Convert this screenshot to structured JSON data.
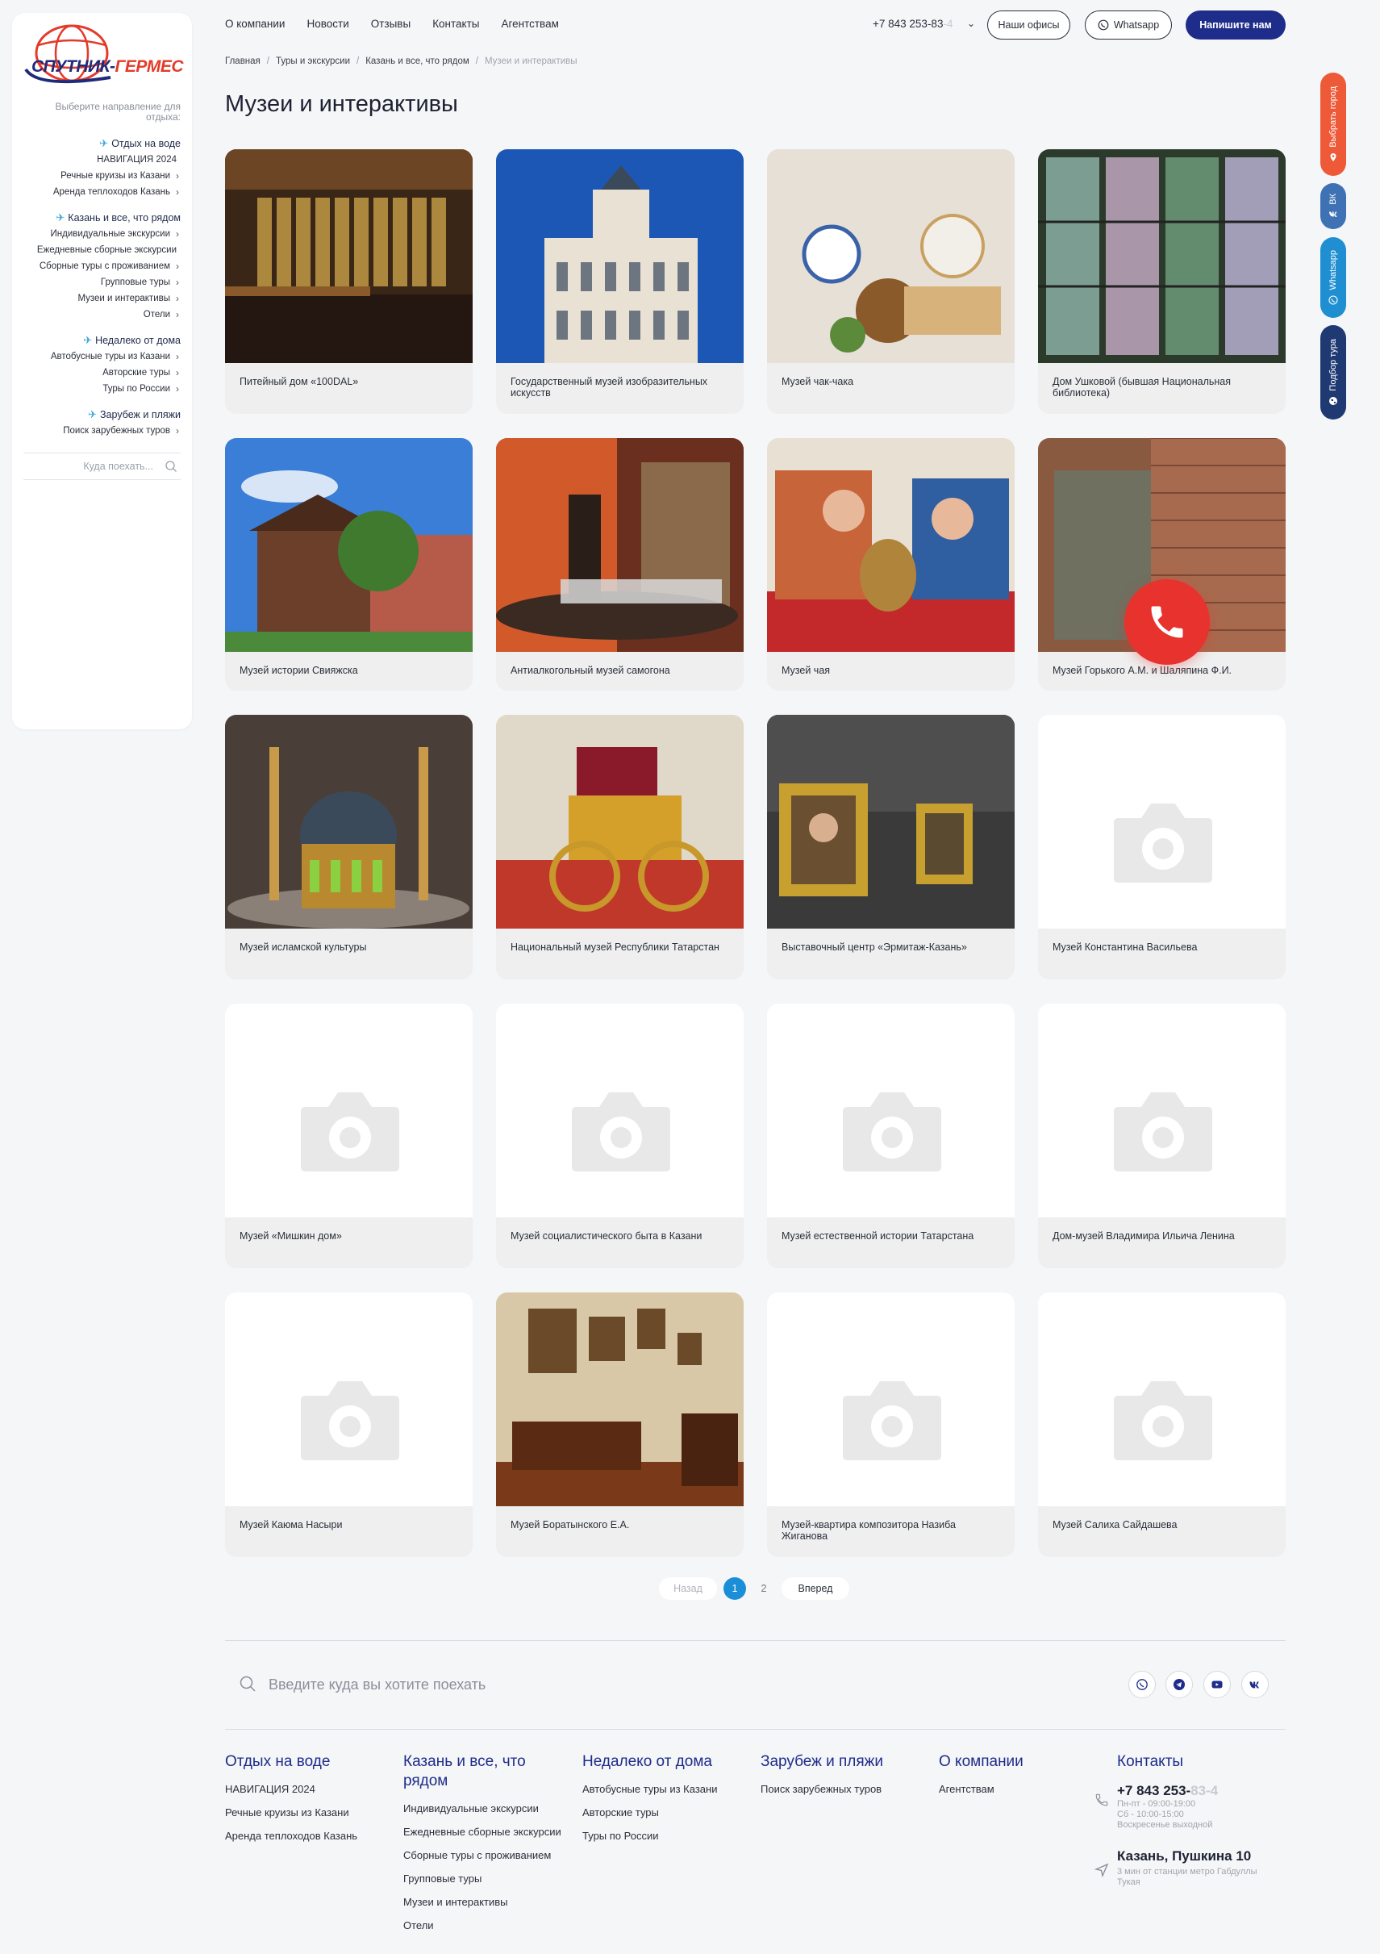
{
  "brand": {
    "name_part1": "СПУТНИК-",
    "name_part2": "ГЕРМЕС"
  },
  "sidebar": {
    "caption": "Выберите направление для отдыха:",
    "groups": [
      {
        "title": "Отдых на воде",
        "items": [
          {
            "label": "НАВИГАЦИЯ 2024",
            "chev": false
          },
          {
            "label": "Речные круизы из Казани",
            "chev": true
          },
          {
            "label": "Аренда теплоходов Казань",
            "chev": true
          }
        ]
      },
      {
        "title": "Казань и все, что рядом",
        "items": [
          {
            "label": "Индивидуальные экскурсии",
            "chev": true
          },
          {
            "label": "Ежедневные сборные экскурсии",
            "chev": false
          },
          {
            "label": "Сборные туры с проживанием",
            "chev": true
          },
          {
            "label": "Групповые туры",
            "chev": true
          },
          {
            "label": "Музеи и интерактивы",
            "chev": true
          },
          {
            "label": "Отели",
            "chev": true
          }
        ]
      },
      {
        "title": "Недалеко от дома",
        "items": [
          {
            "label": "Автобусные туры из Казани",
            "chev": true
          },
          {
            "label": "Авторские туры",
            "chev": true
          },
          {
            "label": "Туры по России",
            "chev": true
          }
        ]
      },
      {
        "title": "Зарубеж и пляжи",
        "items": [
          {
            "label": "Поиск зарубежных туров",
            "chev": true
          }
        ]
      }
    ],
    "search_placeholder": "Куда поехать..."
  },
  "topnav": {
    "links": [
      "О компании",
      "Новости",
      "Отзывы",
      "Контакты",
      "Агентствам"
    ],
    "phone_main": "+7 843 253-83",
    "phone_fade": "-4",
    "offices_label": "Наши офисы",
    "whatsapp_label": "Whatsapp",
    "write_label": "Напишите нам"
  },
  "breadcrumb": [
    "Главная",
    "Туры и экскурсии",
    "Казань и все, что рядом",
    "Музеи и интерактивы"
  ],
  "page_title": "Музеи и интерактивы",
  "cards": [
    {
      "title": "Питейный дом «100DAL»",
      "img": "bar"
    },
    {
      "title": "Государственный музей изобразительных искусств",
      "img": "building"
    },
    {
      "title": "Музей чак-чака",
      "img": "table"
    },
    {
      "title": "Дом Ушковой (бывшая Национальная библиотека)",
      "img": "glass"
    },
    {
      "title": "Музей истории Свияжска",
      "img": "house"
    },
    {
      "title": "Антиалкогольный музей самогона",
      "img": "still"
    },
    {
      "title": "Музей чая",
      "img": "tea"
    },
    {
      "title": "Музей Горького А.М. и Шаляпина Ф.И.",
      "img": "cellar"
    },
    {
      "title": "Музей исламской культуры",
      "img": "mosque"
    },
    {
      "title": "Национальный музей Республики Татарстан",
      "img": "carriage"
    },
    {
      "title": "Выставочный центр «Эрмитаж-Казань»",
      "img": "frames"
    },
    {
      "title": "Музей Константина Васильева",
      "img": "placeholder"
    },
    {
      "title": "Музей «Мишкин дом»",
      "img": "placeholder"
    },
    {
      "title": "Музей социалистического быта в Казани",
      "img": "placeholder"
    },
    {
      "title": "Музей естественной истории Татарстана",
      "img": "placeholder"
    },
    {
      "title": "Дом-музей Владимира Ильича Ленина",
      "img": "placeholder"
    },
    {
      "title": "Музей Каюма Насыри",
      "img": "placeholder"
    },
    {
      "title": "Музей Боратынского Е.А.",
      "img": "room"
    },
    {
      "title": "Музей-квартира композитора Назиба Жиганова",
      "img": "placeholder"
    },
    {
      "title": "Музей Салиха Сайдашева",
      "img": "placeholder"
    }
  ],
  "float_tabs": {
    "city": "Выбрать город",
    "vk": "ВК",
    "whatsapp": "Whatsapp",
    "tour": "Подбор тура"
  },
  "pager": {
    "prev": "Назад",
    "pages": [
      "1",
      "2"
    ],
    "next": "Вперед"
  },
  "bottom_search_placeholder": "Введите куда вы хотите поехать",
  "footer": {
    "cols": [
      {
        "title": "Отдых на воде",
        "links": [
          "НАВИГАЦИЯ 2024",
          "Речные круизы из Казани",
          "Аренда теплоходов Казань"
        ]
      },
      {
        "title": "Казань и все, что рядом",
        "links": [
          "Индивидуальные экскурсии",
          "Ежедневные сборные экскурсии",
          "Сборные туры с проживанием",
          "Групповые туры",
          "Музеи и интерактивы",
          "Отели"
        ]
      },
      {
        "title": "Недалеко от дома",
        "links": [
          "Автобусные туры из Казани",
          "Авторские туры",
          "Туры по России"
        ]
      },
      {
        "title": "Зарубеж и пляжи",
        "links": [
          "Поиск зарубежных туров"
        ]
      },
      {
        "title": "О компании",
        "links": [
          "Агентствам"
        ]
      }
    ],
    "contacts_title": "Контакты",
    "phone_main": "+7 843 253-",
    "phone_fade": "83-4",
    "hours": [
      "Пн-пт - 09:00-19:00",
      "Сб - 10:00-15:00",
      "Воскресенье выходной"
    ],
    "address": "Казань, Пушкина 10",
    "address_note": "3 мин от станции метро Габдуллы Тукая"
  },
  "colors": {
    "brand_blue": "#1e2c8a",
    "accent_red": "#e8322d",
    "pager_blue": "#1b8ed8"
  }
}
